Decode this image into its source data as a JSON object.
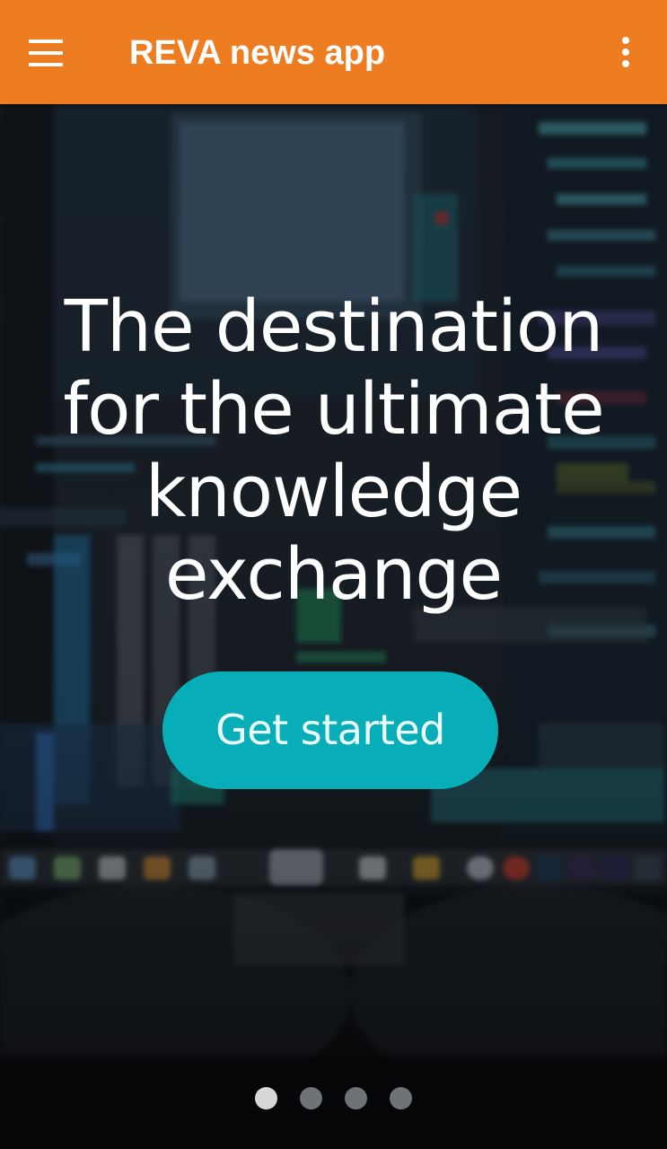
{
  "app_bar": {
    "title": "REVA news app",
    "menu_icon": "hamburger-menu-icon",
    "overflow_icon": "more-vert-icon",
    "background_color": "#EE7D21"
  },
  "onboarding": {
    "headline_lines": [
      "The destination",
      "for the ultimate",
      "knowledge",
      "exchange"
    ],
    "cta_label": "Get started",
    "cta_color": "#07AEB8",
    "page_count": 4,
    "active_page": 1
  }
}
